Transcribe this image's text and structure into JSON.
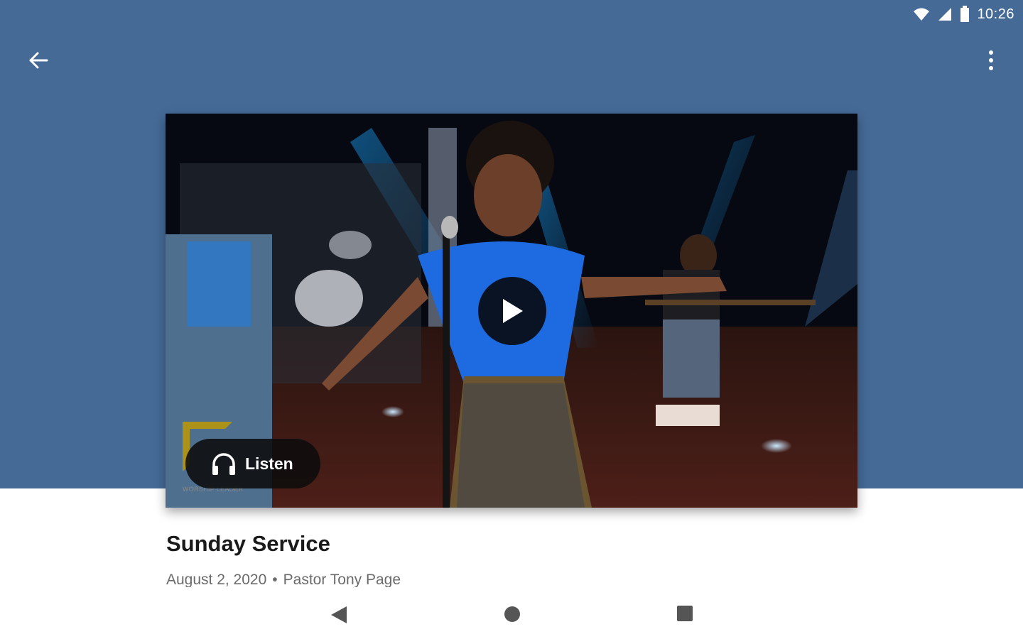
{
  "status_bar": {
    "time": "10:26",
    "icons": [
      "wifi-icon",
      "cell-signal-icon",
      "battery-icon"
    ]
  },
  "app_bar": {
    "back_icon": "arrow-left-icon",
    "menu_icon": "more-vertical-icon"
  },
  "media": {
    "play_icon": "play-icon",
    "listen_label": "Listen",
    "listen_icon": "headphones-icon",
    "logo_text": "WORSHIP LEADER"
  },
  "content": {
    "title": "Sunday Service",
    "date": "August 2, 2020",
    "separator": "•",
    "speaker": "Pastor Tony Page"
  },
  "navigation": {
    "icons": [
      "back-triangle-icon",
      "home-circle-icon",
      "recents-square-icon"
    ]
  },
  "colors": {
    "header": "#456a96",
    "background": "#ffffff",
    "title_text": "#1a1a1a",
    "subtitle_text": "#6b6b6b"
  }
}
